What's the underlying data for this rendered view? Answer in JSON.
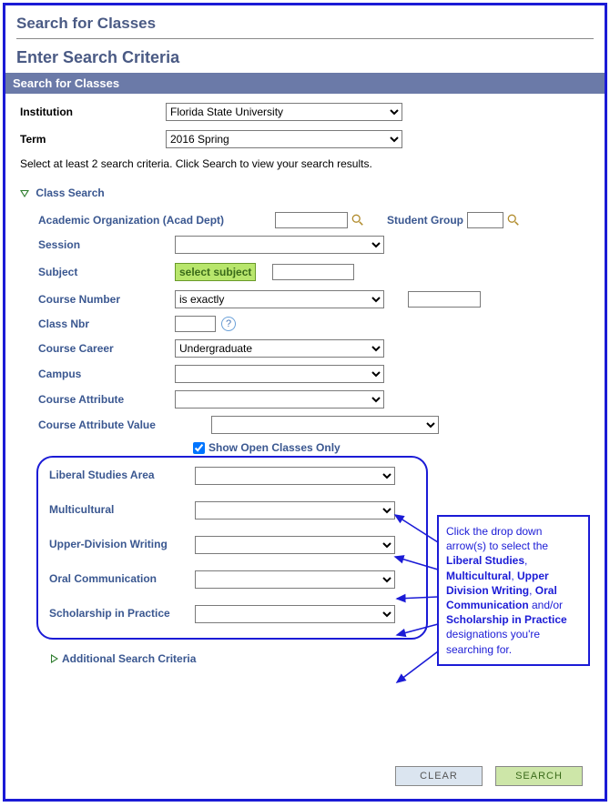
{
  "page_title": "Search for Classes",
  "sub_title": "Enter Search Criteria",
  "section_bar": "Search for Classes",
  "institution_label": "Institution",
  "institution_value": "Florida State University",
  "term_label": "Term",
  "term_value": "2016 Spring",
  "instruction": "Select at least 2 search criteria. Click Search to view your search results.",
  "class_search_hdr": "Class Search",
  "fields": {
    "acad_org": "Academic Organization (Acad Dept)",
    "student_group": "Student Group",
    "session": "Session",
    "subject": "Subject",
    "select_subject_btn": "select subject",
    "course_number": "Course Number",
    "course_number_op": "is exactly",
    "class_nbr": "Class Nbr",
    "course_career": "Course Career",
    "course_career_val": "Undergraduate",
    "campus": "Campus",
    "course_attr": "Course Attribute",
    "course_attr_val": "Course Attribute Value",
    "show_open": "Show Open Classes Only"
  },
  "liberal": {
    "area": "Liberal Studies Area",
    "multi": "Multicultural",
    "upper": "Upper-Division Writing",
    "oral": "Oral Communication",
    "scholar": "Scholarship in Practice"
  },
  "callout": {
    "t1": "Click the drop down arrow(s) to select the ",
    "b1": "Liberal Studies",
    "t2": ", ",
    "b2": "Multicultural",
    "t3": ", ",
    "b3": "Upper Division Writing",
    "t4": ", ",
    "b4": "Oral Communication",
    "t5": " and/or ",
    "b5": "Scholarship in Practice",
    "t6": " designations you're searching for."
  },
  "additional_hdr": "Additional Search Criteria",
  "buttons": {
    "clear": "Clear",
    "search": "Search"
  }
}
